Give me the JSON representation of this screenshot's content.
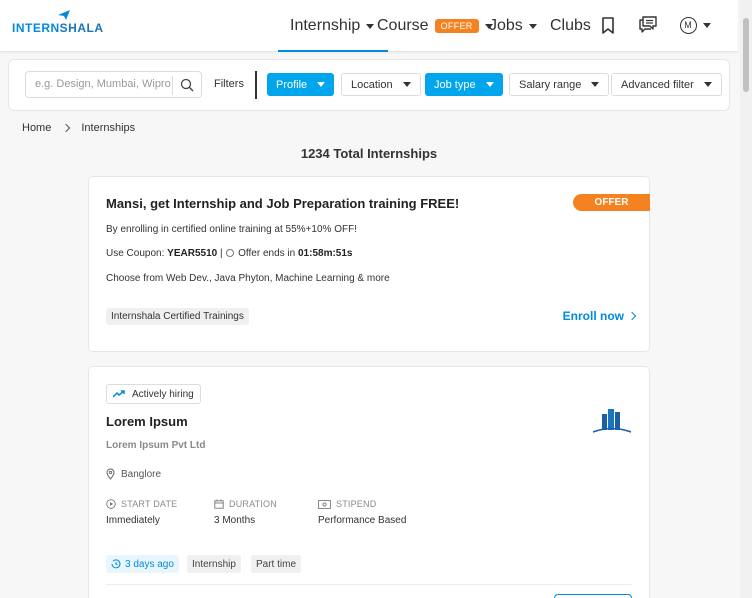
{
  "brand": {
    "logo_text_part1": "INTERN",
    "logo_text_part2": "SHALA",
    "accent": "#008bdc",
    "offer_orange": "#f58220"
  },
  "nav": {
    "internship": "Internship",
    "course": "Course",
    "course_badge": "OFFER",
    "jobs": "Jobs",
    "clubs": "Clubs",
    "avatar_initial": "M",
    "icons": [
      "bookmark-icon",
      "chat-icon",
      "avatar-icon"
    ]
  },
  "filters": {
    "search_placeholder": "e.g. Design, Mumbai, Wipro",
    "label": "Filters",
    "buttons": [
      {
        "label": "Profile",
        "active": true
      },
      {
        "label": "Location",
        "active": false
      },
      {
        "label": "Job type",
        "active": true
      },
      {
        "label": "Salary range",
        "active": false
      },
      {
        "label": "Advanced filter",
        "active": false
      }
    ]
  },
  "breadcrumb": {
    "home": "Home",
    "current": "Internships"
  },
  "total_label": "1234 Total Internships",
  "promo": {
    "title": "Mansi, get Internship and Job Preparation training FREE!",
    "ribbon": "OFFER",
    "line1": "By enrolling in certified online training at 55%+10% OFF!",
    "coupon_prefix": "Use Coupon:",
    "coupon_code": "YEAR5510",
    "offer_ends_label": "Offer ends in",
    "offer_time": "01:58m:51s",
    "line3": "Choose from Web Dev., Java Phyton, Machine Learning & more",
    "chip": "Internshala Certified Trainings",
    "cta": "Enroll now"
  },
  "job": {
    "badge": "Actively hiring",
    "title": "Lorem Ipsum",
    "company": "Lorem Ipsum Pvt Ltd",
    "location": "Banglore",
    "start_label": "START DATE",
    "start_value": "Immediately",
    "duration_label": "DURATION",
    "duration_value": "3 Months",
    "stipend_label": "STIPEND",
    "stipend_value": "Performance Based",
    "posted": "3 days ago",
    "tags": [
      "Internship",
      "Part time"
    ]
  }
}
